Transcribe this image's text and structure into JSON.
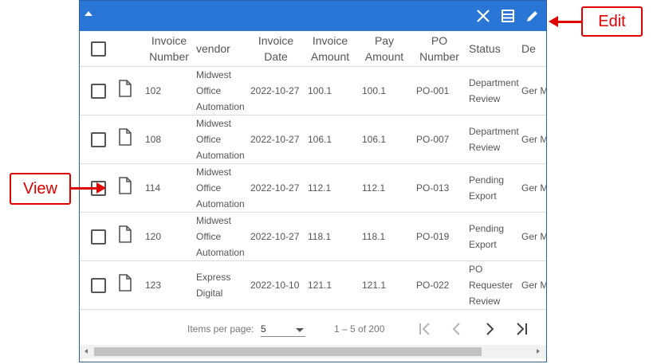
{
  "toolbar": {
    "collapse_icon": "caret-up-icon",
    "close_icon": "close-icon",
    "columns_icon": "columns-icon",
    "edit_icon": "pencil-icon"
  },
  "table": {
    "columns": [
      "Invoice Number",
      "vendor",
      "Invoice Date",
      "Invoice Amount",
      "Pay Amount",
      "PO Number",
      "Status",
      "De"
    ],
    "rows": [
      {
        "invoice_number": "102",
        "vendor": "Midwest Office Automation",
        "invoice_date": "2022-10-27",
        "invoice_amount": "100.1",
        "pay_amount": "100.1",
        "po_number": "PO-001",
        "status": "Department Review",
        "dept": "Ger Mar"
      },
      {
        "invoice_number": "108",
        "vendor": "Midwest Office Automation",
        "invoice_date": "2022-10-27",
        "invoice_amount": "106.1",
        "pay_amount": "106.1",
        "po_number": "PO-007",
        "status": "Department Review",
        "dept": "Ger Mar"
      },
      {
        "invoice_number": "114",
        "vendor": "Midwest Office Automation",
        "invoice_date": "2022-10-27",
        "invoice_amount": "112.1",
        "pay_amount": "112.1",
        "po_number": "PO-013",
        "status": "Pending Export",
        "dept": "Ger Mar"
      },
      {
        "invoice_number": "120",
        "vendor": "Midwest Office Automation",
        "invoice_date": "2022-10-27",
        "invoice_amount": "118.1",
        "pay_amount": "118.1",
        "po_number": "PO-019",
        "status": "Pending Export",
        "dept": "Ger Mar"
      },
      {
        "invoice_number": "123",
        "vendor": "Express Digital",
        "invoice_date": "2022-10-10",
        "invoice_amount": "121.1",
        "pay_amount": "121.1",
        "po_number": "PO-022",
        "status": "PO Requester Review",
        "dept": "Ger Mar"
      }
    ]
  },
  "paginator": {
    "items_per_page_label": "Items per page:",
    "items_per_page_value": "5",
    "range_label": "1 – 5 of 200"
  },
  "annotations": {
    "edit_label": "Edit",
    "view_label": "View"
  },
  "colors": {
    "toolbar_bg": "#2a76d6",
    "callout": "#e00000"
  }
}
